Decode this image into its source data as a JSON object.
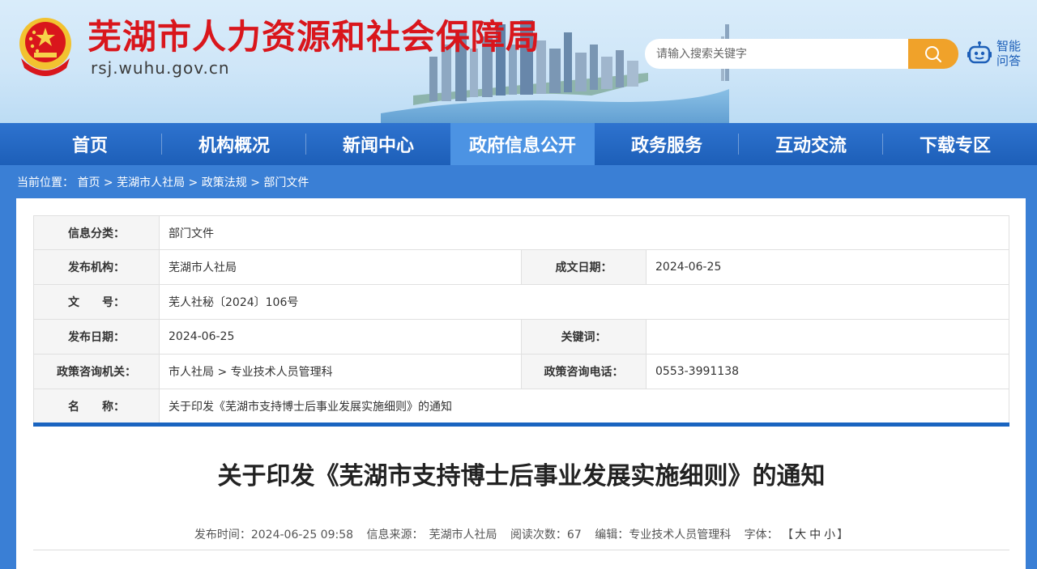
{
  "header": {
    "site_title": "芜湖市人力资源和社会保障局",
    "site_domain": "rsj.wuhu.gov.cn",
    "search": {
      "placeholder": "请输入搜索关键字"
    },
    "qa_label_line1": "智能",
    "qa_label_line2": "问答",
    "icons": {
      "search": "search-icon",
      "robot": "robot-icon",
      "emblem": "national-emblem-icon"
    }
  },
  "nav": {
    "items": [
      {
        "label": "首页"
      },
      {
        "label": "机构概况"
      },
      {
        "label": "新闻中心"
      },
      {
        "label": "政府信息公开"
      },
      {
        "label": "政务服务"
      },
      {
        "label": "互动交流"
      },
      {
        "label": "下载专区"
      }
    ],
    "active_index": 3
  },
  "breadcrumb": {
    "prefix": "当前位置：",
    "items": [
      "首页",
      "芜湖市人社局",
      "政策法规",
      "部门文件"
    ],
    "separator": ">"
  },
  "meta": {
    "category_label": "信息分类：",
    "category": "部门文件",
    "publisher_label": "发布机构：",
    "publisher": "芜湖市人社局",
    "written_date_label": "成文日期：",
    "written_date": "2024-06-25",
    "doc_no_label": "文　　号：",
    "doc_no": "芜人社秘〔2024〕106号",
    "publish_date_label": "发布日期：",
    "publish_date": "2024-06-25",
    "keywords_label": "关键词：",
    "keywords": "",
    "consult_org_label": "政策咨询机关：",
    "consult_org": "市人社局 > 专业技术人员管理科",
    "consult_phone_label": "政策咨询电话：",
    "consult_phone": "0553-3991138",
    "name_label": "名　　称：",
    "name": "关于印发《芜湖市支持博士后事业发展实施细则》的通知"
  },
  "article": {
    "title": "关于印发《芜湖市支持博士后事业发展实施细则》的通知",
    "publish_time": "发布时间：2024-06-25 09:58",
    "source": "信息来源：　芜湖市人社局",
    "views": "阅读次数：67",
    "editor": "编辑：专业技术人员管理科",
    "font_label": "字体：",
    "font_open": "【",
    "font_large": "大",
    "font_medium": "中",
    "font_small": "小",
    "font_close": "】"
  },
  "colors": {
    "brand_red": "#d9161c",
    "nav_blue": "#1d5fb8",
    "active_nav": "#4c93e3",
    "search_orange": "#f0a22a"
  }
}
